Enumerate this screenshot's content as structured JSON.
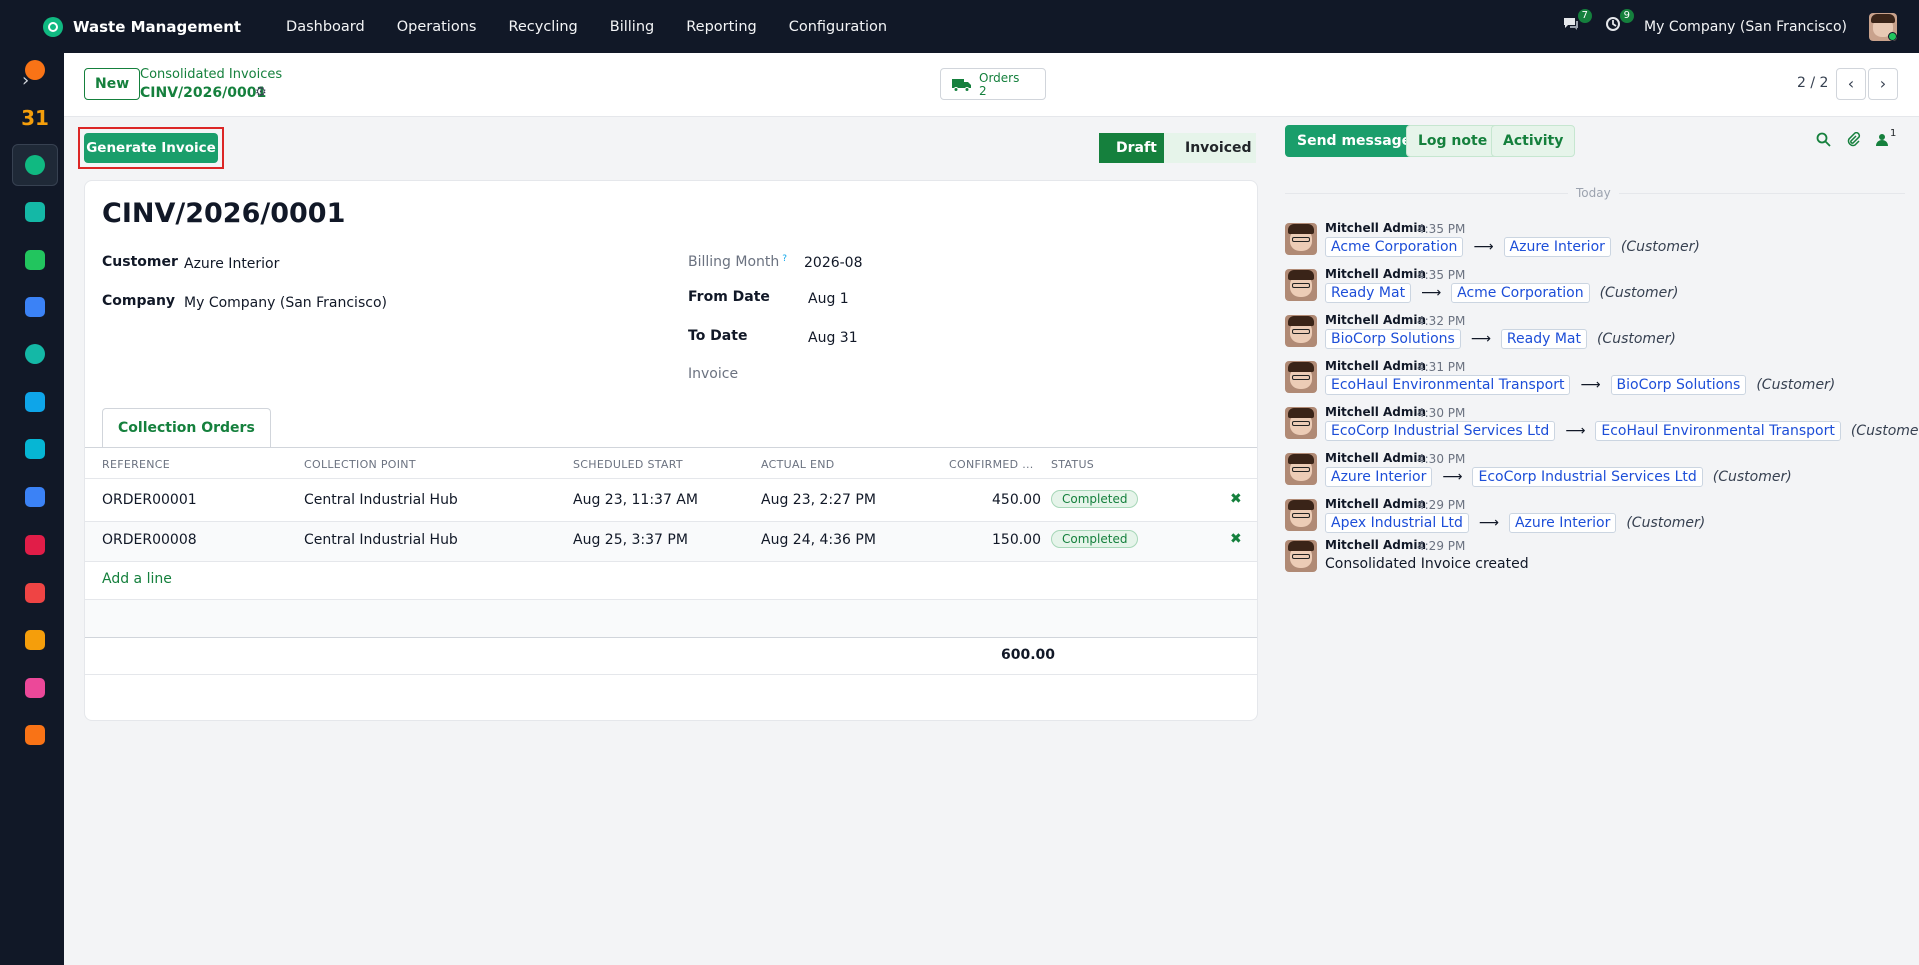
{
  "navbar": {
    "app_name": "Waste Management",
    "menu": [
      "Dashboard",
      "Operations",
      "Recycling",
      "Billing",
      "Reporting",
      "Configuration"
    ],
    "messages_count": "7",
    "activities_count": "9",
    "company": "My Company (San Francisco)"
  },
  "sidebar": {
    "icons": [
      {
        "name": "discuss-icon",
        "color": "#f97316"
      },
      {
        "name": "calendar-icon",
        "color": "#f59e0b"
      },
      {
        "name": "waste-management-icon",
        "color": "#10b981"
      },
      {
        "name": "contacts-icon",
        "color": "#14b8a6"
      },
      {
        "name": "crm-icon",
        "color": "#22c55e"
      },
      {
        "name": "dashboards-icon",
        "color": "#3b82f6"
      },
      {
        "name": "accounting-icon",
        "color": "#14b8a6"
      },
      {
        "name": "invoicing-icon",
        "color": "#0ea5e9"
      },
      {
        "name": "website-icon",
        "color": "#06b6d4"
      },
      {
        "name": "project-icon",
        "color": "#3b82f6"
      },
      {
        "name": "inventory-icon",
        "color": "#e11d48"
      },
      {
        "name": "fleet-icon",
        "color": "#ef4444"
      },
      {
        "name": "sales-icon",
        "color": "#f59e0b"
      },
      {
        "name": "pos-icon",
        "color": "#ec4899"
      },
      {
        "name": "apps-icon",
        "color": "#f97316"
      }
    ],
    "calendar_label": "31"
  },
  "control_panel": {
    "new_label": "New",
    "breadcrumb_parent": "Consolidated Invoices",
    "breadcrumb_current": "CINV/2026/0001",
    "smart_button": {
      "label": "Orders",
      "value": "2"
    },
    "pager": "2 / 2"
  },
  "actions": {
    "generate_invoice": "Generate Invoice"
  },
  "statusbar": {
    "stages": [
      "Draft",
      "Invoiced"
    ],
    "current": "Draft"
  },
  "form": {
    "title": "CINV/2026/0001",
    "customer_label": "Customer",
    "customer_value": "Azure Interior",
    "company_label": "Company",
    "company_value": "My Company (San Francisco)",
    "billing_month_label": "Billing Month",
    "billing_month_help": "?",
    "billing_month_value": "2026-08",
    "from_date_label": "From Date",
    "from_date_value": "Aug 1",
    "to_date_label": "To Date",
    "to_date_value": "Aug 31",
    "invoice_label": "Invoice",
    "tab_label": "Collection Orders",
    "columns": [
      "REFERENCE",
      "COLLECTION POINT",
      "SCHEDULED START",
      "ACTUAL END",
      "CONFIRMED ...",
      "STATUS"
    ],
    "rows": [
      {
        "reference": "ORDER00001",
        "point": "Central Industrial Hub",
        "start": "Aug 23, 11:37 AM",
        "end": "Aug 23, 2:27 PM",
        "confirmed": "450.00",
        "status": "Completed"
      },
      {
        "reference": "ORDER00008",
        "point": "Central Industrial Hub",
        "start": "Aug 25, 3:37 PM",
        "end": "Aug 24, 4:36 PM",
        "confirmed": "150.00",
        "status": "Completed"
      }
    ],
    "add_line": "Add a line",
    "total": "600.00"
  },
  "chatter": {
    "send_message": "Send message",
    "log_note": "Log note",
    "activity": "Activity",
    "followers_count": "1",
    "today": "Today",
    "messages": [
      {
        "author": "Mitchell Admin",
        "time": "4:35 PM",
        "old": "Acme Corporation",
        "new": "Azure Interior",
        "field": "(Customer)"
      },
      {
        "author": "Mitchell Admin",
        "time": "4:35 PM",
        "old": "Ready Mat",
        "new": "Acme Corporation",
        "field": "(Customer)"
      },
      {
        "author": "Mitchell Admin",
        "time": "4:32 PM",
        "old": "BioCorp Solutions",
        "new": "Ready Mat",
        "field": "(Customer)"
      },
      {
        "author": "Mitchell Admin",
        "time": "4:31 PM",
        "old": "EcoHaul Environmental Transport",
        "new": "BioCorp Solutions",
        "field": "(Customer)"
      },
      {
        "author": "Mitchell Admin",
        "time": "4:30 PM",
        "old": "EcoCorp Industrial Services Ltd",
        "new": "EcoHaul Environmental Transport",
        "field": "(Customer)"
      },
      {
        "author": "Mitchell Admin",
        "time": "4:30 PM",
        "old": "Azure Interior",
        "new": "EcoCorp Industrial Services Ltd",
        "field": "(Customer)"
      },
      {
        "author": "Mitchell Admin",
        "time": "4:29 PM",
        "old": "Apex Industrial Ltd",
        "new": "Azure Interior",
        "field": "(Customer)"
      }
    ],
    "created": {
      "author": "Mitchell Admin",
      "time": "4:29 PM",
      "body": "Consolidated Invoice created"
    }
  }
}
